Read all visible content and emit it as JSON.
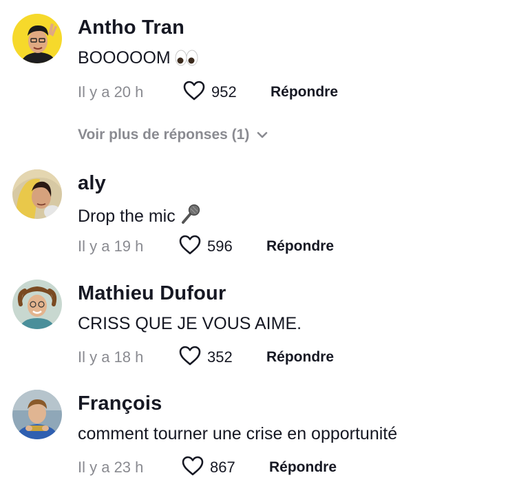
{
  "comments": [
    {
      "username": "Antho Tran",
      "text": "BOOOOOM",
      "emoji": "eyes-icon",
      "time": "Il y a 20 h",
      "likes": "952",
      "reply_label": "Répondre"
    },
    {
      "username": "aly",
      "text": "Drop the mic",
      "emoji": "microphone-icon",
      "time": "Il y a 19 h",
      "likes": "596",
      "reply_label": "Répondre"
    },
    {
      "username": "Mathieu Dufour",
      "text": "CRISS QUE JE VOUS AIME.",
      "time": "Il y a 18 h",
      "likes": "352",
      "reply_label": "Répondre"
    },
    {
      "username": "François",
      "text": "comment tourner une crise en opportunité",
      "time": "Il y a 23 h",
      "likes": "867",
      "reply_label": "Répondre"
    }
  ],
  "more_replies": {
    "label": "Voir plus de réponses (1)",
    "icon": "chevron-down-icon"
  },
  "colors": {
    "text": "#161823",
    "muted": "#8a8b91",
    "background": "#ffffff"
  }
}
